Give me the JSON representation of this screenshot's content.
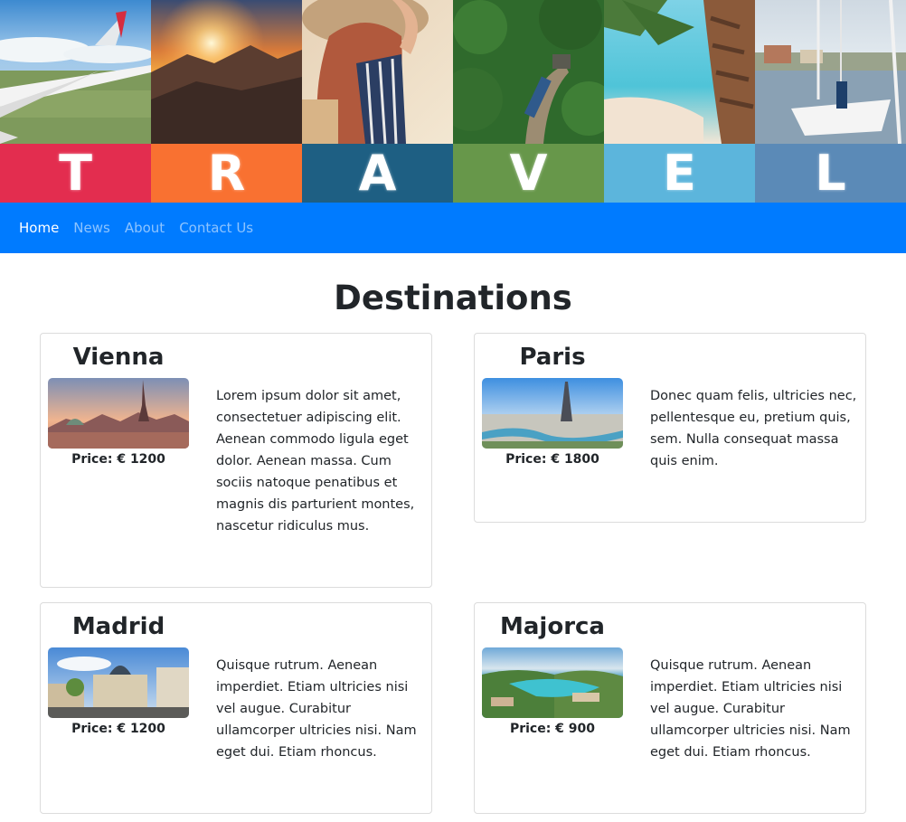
{
  "banner": {
    "letters": [
      "T",
      "R",
      "A",
      "V",
      "E",
      "L"
    ],
    "letter_colors": [
      "#e32d4f",
      "#f97131",
      "#1e5f83",
      "#67974a",
      "#5cb5dc",
      "#5b8ab7"
    ]
  },
  "nav": {
    "background": "#007bff",
    "items": [
      {
        "label": "Home",
        "active": true
      },
      {
        "label": "News",
        "active": false
      },
      {
        "label": "About",
        "active": false
      },
      {
        "label": "Contact Us",
        "active": false
      }
    ]
  },
  "page": {
    "title": "Destinations"
  },
  "destinations": [
    {
      "name": "Vienna",
      "price": "Price: € 1200",
      "description": "Lorem ipsum dolor sit amet, consectetuer adipiscing elit. Aenean commodo ligula eget dolor. Aenean massa. Cum sociis natoque penatibus et magnis dis parturient montes, nascetur ridiculus mus."
    },
    {
      "name": "Paris",
      "price": "Price: € 1800",
      "description": "Donec quam felis, ultricies nec, pellentesque eu, pretium quis, sem. Nulla consequat massa quis enim."
    },
    {
      "name": "Madrid",
      "price": "Price: € 1200",
      "description": "Quisque rutrum. Aenean imperdiet. Etiam ultricies nisi vel augue. Curabitur ullamcorper ultricies nisi. Nam eget dui. Etiam rhoncus."
    },
    {
      "name": "Majorca",
      "price": "Price: € 900",
      "description": "Quisque rutrum. Aenean imperdiet. Etiam ultricies nisi vel augue. Curabitur ullamcorper ultricies nisi. Nam eget dui. Etiam rhoncus."
    }
  ]
}
